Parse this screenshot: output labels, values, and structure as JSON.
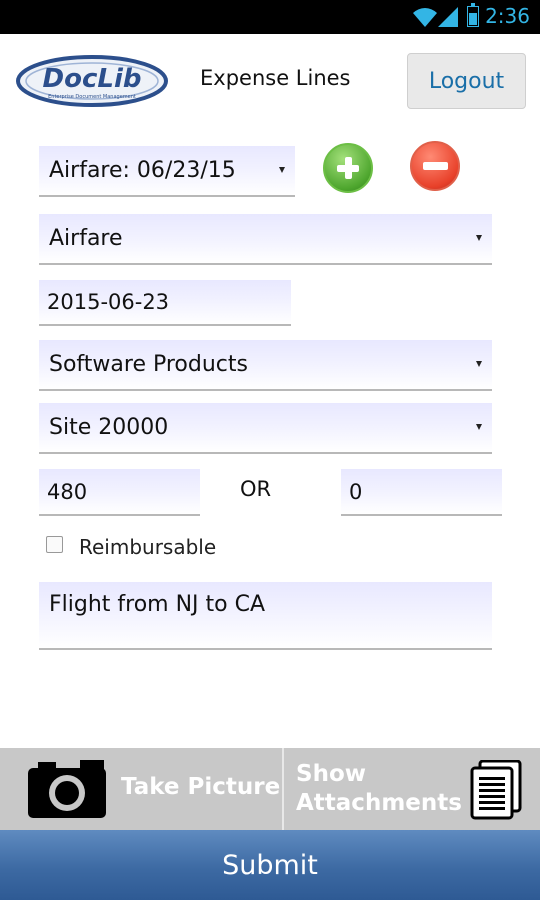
{
  "status_bar": {
    "time": "2:36"
  },
  "header": {
    "logo_text": "DocLib",
    "logo_tagline": "Enterprise Document Management",
    "title": "Expense Lines",
    "logout_label": "Logout"
  },
  "form": {
    "expense_line_select": "Airfare: 06/23/15",
    "expense_type_select": "Airfare",
    "date_value": "2015-06-23",
    "category_select": "Software Products",
    "site_select": "Site 20000",
    "amount_value": "480",
    "or_label": "OR",
    "alt_amount_value": "0",
    "reimbursable_label": "Reimbursable",
    "reimbursable_checked": false,
    "description_value": "Flight from NJ to CA"
  },
  "bottom_bar": {
    "take_picture_label": "Take Picture",
    "show_line1": "Show",
    "show_line2": "Attachments"
  },
  "submit_label": "Submit",
  "colors": {
    "status_accent": "#33b5e5",
    "logout_text": "#1a6fa8",
    "field_tint": "#e8e8ff",
    "submit_bar": "#3d6aa3",
    "add_green": "#4ea62e",
    "remove_red": "#e8412a"
  }
}
